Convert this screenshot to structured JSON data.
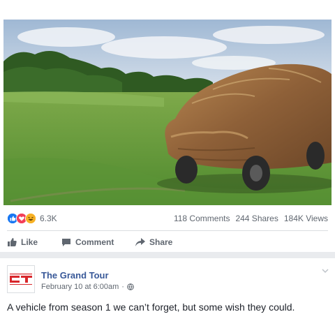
{
  "post": {
    "image_alt": "Hay-covered vehicle parked in a green field",
    "reaction_icons": [
      "like-icon",
      "love-icon",
      "haha-icon"
    ],
    "reaction_count": "6.3K",
    "comments": "118 Comments",
    "shares": "244 Shares",
    "views": "184K Views"
  },
  "actions": {
    "like": "Like",
    "comment": "Comment",
    "share": "Share"
  },
  "page": {
    "name": "The Grand Tour",
    "date": "February 10 at 6:00am",
    "separator": "·",
    "privacy_icon": "globe-icon",
    "text": "A vehicle from season 1 we can’t forget, but some wish they could."
  },
  "colors": {
    "link_blue": "#385898",
    "like_blue": "#1877f2",
    "love_red": "#f33e58",
    "haha_yellow": "#f7b125",
    "brand_red": "#d8262b"
  }
}
